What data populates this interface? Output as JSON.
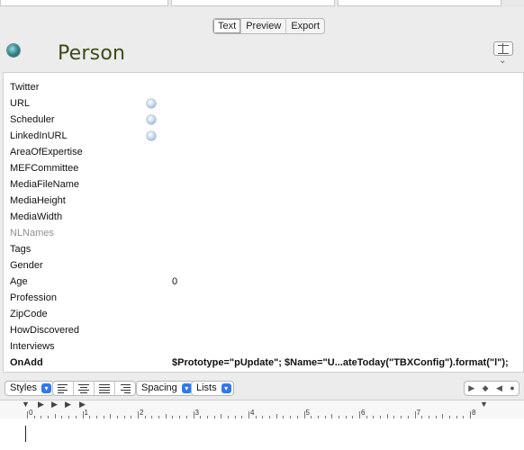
{
  "tabs": [
    {
      "label": "Text",
      "active": true
    },
    {
      "label": "Preview",
      "active": false
    },
    {
      "label": "Export",
      "active": false
    }
  ],
  "header": {
    "title": "Person",
    "badge_color": "#3c8f98",
    "title_color": "#3b4c12"
  },
  "attributes": [
    {
      "name": "Twitter",
      "value": "",
      "has_dot": false,
      "style": "normal"
    },
    {
      "name": "URL",
      "value": "",
      "has_dot": true,
      "style": "normal"
    },
    {
      "name": "Scheduler",
      "value": "",
      "has_dot": true,
      "style": "normal"
    },
    {
      "name": "LinkedInURL",
      "value": "",
      "has_dot": true,
      "style": "normal"
    },
    {
      "name": "AreaOfExpertise",
      "value": "",
      "has_dot": false,
      "style": "normal"
    },
    {
      "name": "MEFCommittee",
      "value": "",
      "has_dot": false,
      "style": "normal"
    },
    {
      "name": "MediaFileName",
      "value": "",
      "has_dot": false,
      "style": "normal"
    },
    {
      "name": "MediaHeight",
      "value": "",
      "has_dot": false,
      "style": "normal"
    },
    {
      "name": "MediaWidth",
      "value": "",
      "has_dot": false,
      "style": "normal"
    },
    {
      "name": "NLNames",
      "value": "",
      "has_dot": false,
      "style": "dim"
    },
    {
      "name": "Tags",
      "value": "",
      "has_dot": false,
      "style": "normal"
    },
    {
      "name": "Gender",
      "value": "",
      "has_dot": false,
      "style": "normal"
    },
    {
      "name": "Age",
      "value": "0",
      "has_dot": false,
      "style": "normal"
    },
    {
      "name": "Profession",
      "value": "",
      "has_dot": false,
      "style": "normal"
    },
    {
      "name": "ZipCode",
      "value": "",
      "has_dot": false,
      "style": "normal"
    },
    {
      "name": "HowDiscovered",
      "value": "",
      "has_dot": false,
      "style": "normal"
    },
    {
      "name": "Interviews",
      "value": "",
      "has_dot": false,
      "style": "normal"
    },
    {
      "name": "OnAdd",
      "value": "$Prototype=\"pUpdate\"; $Name=\"U...ateToday(\"TBXConfig\").format(\"l\");",
      "has_dot": false,
      "style": "bold"
    }
  ],
  "toolbar": {
    "styles_label": "Styles",
    "spacing_label": "Spacing",
    "lists_label": "Lists",
    "nav_icons": [
      "play-right-icon",
      "diamond-icon",
      "play-left-icon",
      "circle-icon"
    ]
  },
  "ruler": {
    "numbers": [
      "0",
      "1",
      "2",
      "3",
      "4",
      "5",
      "6",
      "7",
      "8"
    ]
  },
  "accent_color": "#2f7ae5"
}
